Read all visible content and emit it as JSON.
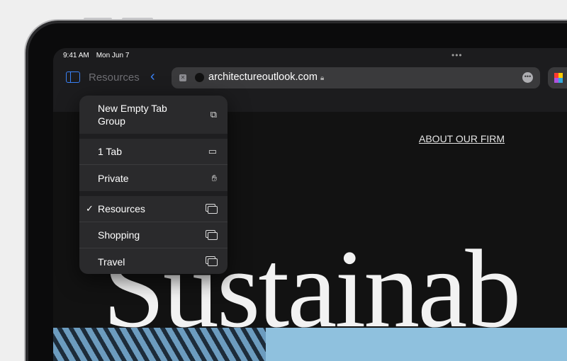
{
  "status": {
    "time": "9:41 AM",
    "date": "Mon Jun 7"
  },
  "toolbar": {
    "tab_group": "Resources",
    "url": "architectureoutlook.com"
  },
  "page": {
    "nav_link": "ABOUT OUR FIRM",
    "headline": "Sustainab"
  },
  "menu": {
    "new_group": "New Empty Tab Group",
    "items": [
      {
        "label": "1 Tab",
        "icon": "tab-icon"
      },
      {
        "label": "Private",
        "icon": "hand-icon"
      },
      {
        "label": "Resources",
        "icon": "tabs-icon",
        "checked": true
      },
      {
        "label": "Shopping",
        "icon": "tabs-icon"
      },
      {
        "label": "Travel",
        "icon": "tabs-icon"
      }
    ]
  }
}
